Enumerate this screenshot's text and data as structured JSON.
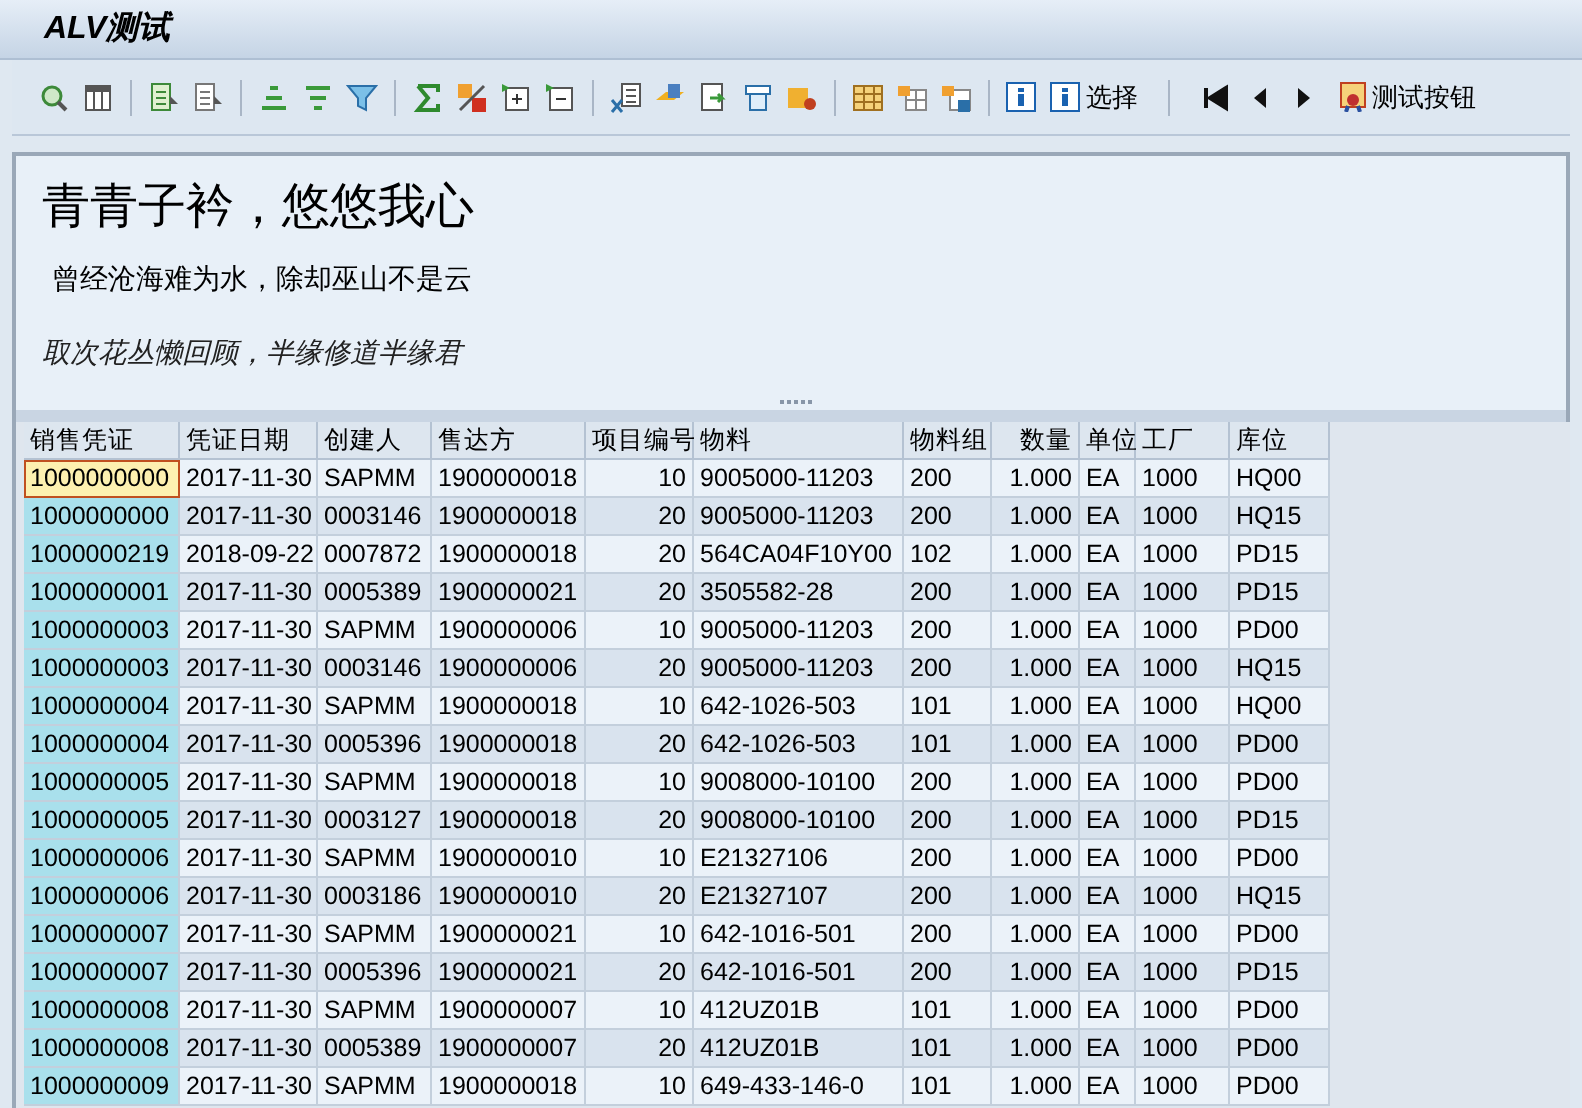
{
  "window": {
    "title": "ALV测试"
  },
  "toolbar": {
    "buttons": [
      {
        "label": "选择"
      },
      {
        "label": "测试按钮"
      }
    ]
  },
  "header": {
    "title": "青青子衿，悠悠我心",
    "line": "曾经沧海难为水，除却巫山不是云",
    "italic_line": "取次花丛懒回顾，半缘修道半缘君"
  },
  "table": {
    "columns": [
      {
        "label": "销售凭证",
        "kind": "key"
      },
      {
        "label": "凭证日期",
        "kind": "text"
      },
      {
        "label": "创建人",
        "kind": "text"
      },
      {
        "label": "售达方",
        "kind": "text"
      },
      {
        "label": "项目编号",
        "kind": "number"
      },
      {
        "label": "物料",
        "kind": "text"
      },
      {
        "label": "物料组",
        "kind": "text"
      },
      {
        "label": "数量",
        "kind": "number"
      },
      {
        "label": "单位",
        "kind": "text"
      },
      {
        "label": "工厂",
        "kind": "text"
      },
      {
        "label": "库位",
        "kind": "text"
      }
    ],
    "rows": [
      {
        "selected": true,
        "cells": [
          "1000000000",
          "2017-11-30",
          "SAPMM",
          "1900000018",
          "10",
          "9005000-11203",
          "200",
          "1.000",
          "EA",
          "1000",
          "HQ00"
        ]
      },
      {
        "selected": false,
        "cells": [
          "1000000000",
          "2017-11-30",
          "0003146",
          "1900000018",
          "20",
          "9005000-11203",
          "200",
          "1.000",
          "EA",
          "1000",
          "HQ15"
        ]
      },
      {
        "selected": false,
        "cells": [
          "1000000219",
          "2018-09-22",
          "0007872",
          "1900000018",
          "20",
          "564CA04F10Y00",
          "102",
          "1.000",
          "EA",
          "1000",
          "PD15"
        ]
      },
      {
        "selected": false,
        "cells": [
          "1000000001",
          "2017-11-30",
          "0005389",
          "1900000021",
          "20",
          "3505582-28",
          "200",
          "1.000",
          "EA",
          "1000",
          "PD15"
        ]
      },
      {
        "selected": false,
        "cells": [
          "1000000003",
          "2017-11-30",
          "SAPMM",
          "1900000006",
          "10",
          "9005000-11203",
          "200",
          "1.000",
          "EA",
          "1000",
          "PD00"
        ]
      },
      {
        "selected": false,
        "cells": [
          "1000000003",
          "2017-11-30",
          "0003146",
          "1900000006",
          "20",
          "9005000-11203",
          "200",
          "1.000",
          "EA",
          "1000",
          "HQ15"
        ]
      },
      {
        "selected": false,
        "cells": [
          "1000000004",
          "2017-11-30",
          "SAPMM",
          "1900000018",
          "10",
          "642-1026-503",
          "101",
          "1.000",
          "EA",
          "1000",
          "HQ00"
        ]
      },
      {
        "selected": false,
        "cells": [
          "1000000004",
          "2017-11-30",
          "0005396",
          "1900000018",
          "20",
          "642-1026-503",
          "101",
          "1.000",
          "EA",
          "1000",
          "PD00"
        ]
      },
      {
        "selected": false,
        "cells": [
          "1000000005",
          "2017-11-30",
          "SAPMM",
          "1900000018",
          "10",
          "9008000-10100",
          "200",
          "1.000",
          "EA",
          "1000",
          "PD00"
        ]
      },
      {
        "selected": false,
        "cells": [
          "1000000005",
          "2017-11-30",
          "0003127",
          "1900000018",
          "20",
          "9008000-10100",
          "200",
          "1.000",
          "EA",
          "1000",
          "PD15"
        ]
      },
      {
        "selected": false,
        "cells": [
          "1000000006",
          "2017-11-30",
          "SAPMM",
          "1900000010",
          "10",
          "E21327106",
          "200",
          "1.000",
          "EA",
          "1000",
          "PD00"
        ]
      },
      {
        "selected": false,
        "cells": [
          "1000000006",
          "2017-11-30",
          "0003186",
          "1900000010",
          "20",
          "E21327107",
          "200",
          "1.000",
          "EA",
          "1000",
          "HQ15"
        ]
      },
      {
        "selected": false,
        "cells": [
          "1000000007",
          "2017-11-30",
          "SAPMM",
          "1900000021",
          "10",
          "642-1016-501",
          "200",
          "1.000",
          "EA",
          "1000",
          "PD00"
        ]
      },
      {
        "selected": false,
        "cells": [
          "1000000007",
          "2017-11-30",
          "0005396",
          "1900000021",
          "20",
          "642-1016-501",
          "200",
          "1.000",
          "EA",
          "1000",
          "PD15"
        ]
      },
      {
        "selected": false,
        "cells": [
          "1000000008",
          "2017-11-30",
          "SAPMM",
          "1900000007",
          "10",
          "412UZ01B",
          "101",
          "1.000",
          "EA",
          "1000",
          "PD00"
        ]
      },
      {
        "selected": false,
        "cells": [
          "1000000008",
          "2017-11-30",
          "0005389",
          "1900000007",
          "20",
          "412UZ01B",
          "101",
          "1.000",
          "EA",
          "1000",
          "PD00"
        ]
      },
      {
        "selected": false,
        "cells": [
          "1000000009",
          "2017-11-30",
          "SAPMM",
          "1900000018",
          "10",
          "649-433-146-0",
          "101",
          "1.000",
          "EA",
          "1000",
          "PD00"
        ]
      }
    ]
  }
}
